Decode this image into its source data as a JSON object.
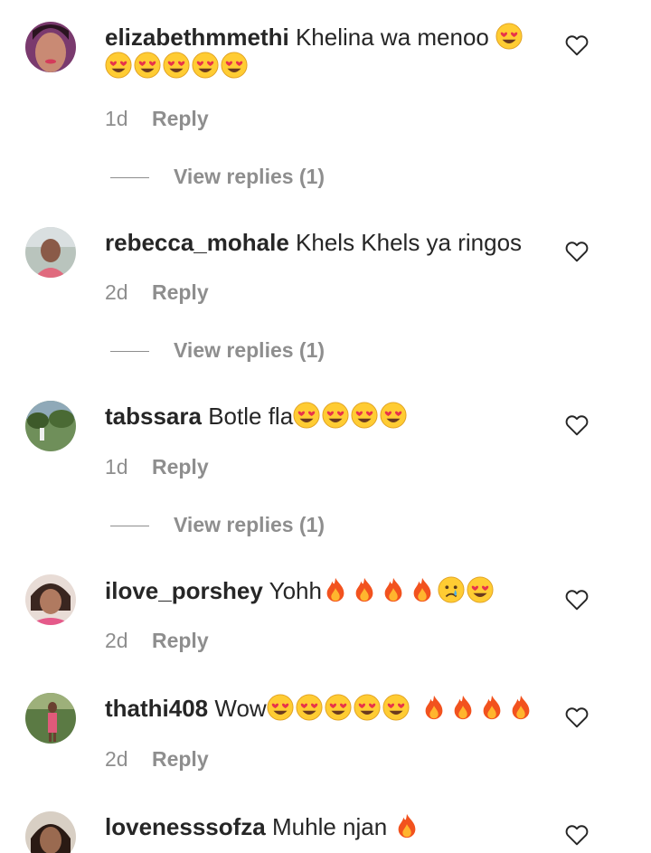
{
  "comments": [
    {
      "username": "elizabethmmethi",
      "text": "Khelina wa menoo",
      "emojis": [
        "heart-eyes-emoji"
      ],
      "emojis_line2": [
        "heart-eyes-emoji",
        "heart-eyes-emoji",
        "heart-eyes-emoji",
        "heart-eyes-emoji",
        "heart-eyes-emoji"
      ],
      "time": "1d",
      "reply_label": "Reply",
      "view_replies": "View replies (1)"
    },
    {
      "username": "rebecca_mohale",
      "text": "Khels Khels ya ringos",
      "emojis": [],
      "time": "2d",
      "reply_label": "Reply",
      "view_replies": "View replies (1)"
    },
    {
      "username": "tabssara",
      "text": "Botle fla",
      "emojis": [
        "heart-eyes-emoji",
        "heart-eyes-emoji",
        "heart-eyes-emoji",
        "heart-eyes-emoji"
      ],
      "time": "1d",
      "reply_label": "Reply",
      "view_replies": "View replies (1)"
    },
    {
      "username": "ilove_porshey",
      "text": "Yohh",
      "emojis": [
        "fire-emoji",
        "fire-emoji",
        "fire-emoji",
        "fire-emoji",
        "crying-face-emoji",
        "heart-eyes-emoji"
      ],
      "time": "2d",
      "reply_label": "Reply"
    },
    {
      "username": "thathi408",
      "text": "Wow",
      "emojis": [
        "heart-eyes-emoji",
        "heart-eyes-emoji",
        "heart-eyes-emoji",
        "heart-eyes-emoji",
        "heart-eyes-emoji",
        "fire-emoji",
        "fire-emoji",
        "fire-emoji",
        "fire-emoji"
      ],
      "time": "2d",
      "reply_label": "Reply"
    },
    {
      "username": "lovenesssofza",
      "text": "Muhle njan",
      "emojis": [
        "fire-emoji"
      ]
    }
  ],
  "icons": {
    "like": "heart-outline-icon"
  },
  "colors": {
    "text": "#262626",
    "secondary": "#8e8e8e",
    "background": "#ffffff"
  }
}
